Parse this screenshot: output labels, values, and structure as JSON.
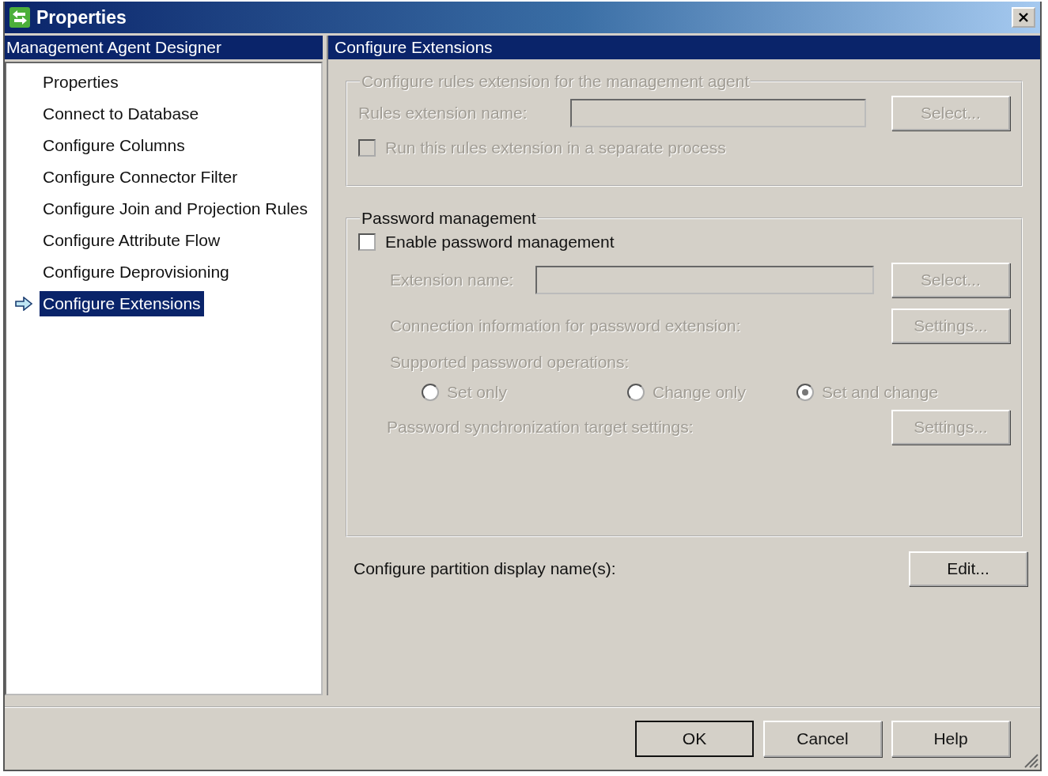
{
  "window": {
    "title": "Properties"
  },
  "sidebar": {
    "header": "Management Agent Designer",
    "items": [
      {
        "label": "Properties",
        "selected": false
      },
      {
        "label": "Connect to Database",
        "selected": false
      },
      {
        "label": "Configure Columns",
        "selected": false
      },
      {
        "label": "Configure Connector Filter",
        "selected": false
      },
      {
        "label": "Configure Join and Projection Rules",
        "selected": false
      },
      {
        "label": "Configure Attribute Flow",
        "selected": false
      },
      {
        "label": "Configure Deprovisioning",
        "selected": false
      },
      {
        "label": "Configure Extensions",
        "selected": true
      }
    ]
  },
  "panel": {
    "header": "Configure Extensions",
    "rules_group": {
      "title": "Configure rules extension for the management agent",
      "disabled": true,
      "name_label": "Rules extension name:",
      "select_button": "Select...",
      "separate_process": {
        "label": "Run this rules extension in a separate process",
        "checked": false
      }
    },
    "password_group": {
      "title": "Password management",
      "enable": {
        "label": "Enable password management",
        "checked": false
      },
      "disabled": true,
      "extension_label": "Extension name:",
      "select_button": "Select...",
      "connection_label": "Connection information for password extension:",
      "connection_button": "Settings...",
      "operations_label": "Supported password operations:",
      "operations": [
        {
          "label": "Set only",
          "selected": false
        },
        {
          "label": "Change only",
          "selected": false
        },
        {
          "label": "Set and change",
          "selected": true
        }
      ],
      "sync_label": "Password synchronization target settings:",
      "sync_button": "Settings..."
    },
    "partition": {
      "label": "Configure partition display name(s):",
      "button": "Edit..."
    }
  },
  "buttons": [
    {
      "label": "OK",
      "default": true
    },
    {
      "label": "Cancel",
      "default": false
    },
    {
      "label": "Help",
      "default": false
    }
  ]
}
